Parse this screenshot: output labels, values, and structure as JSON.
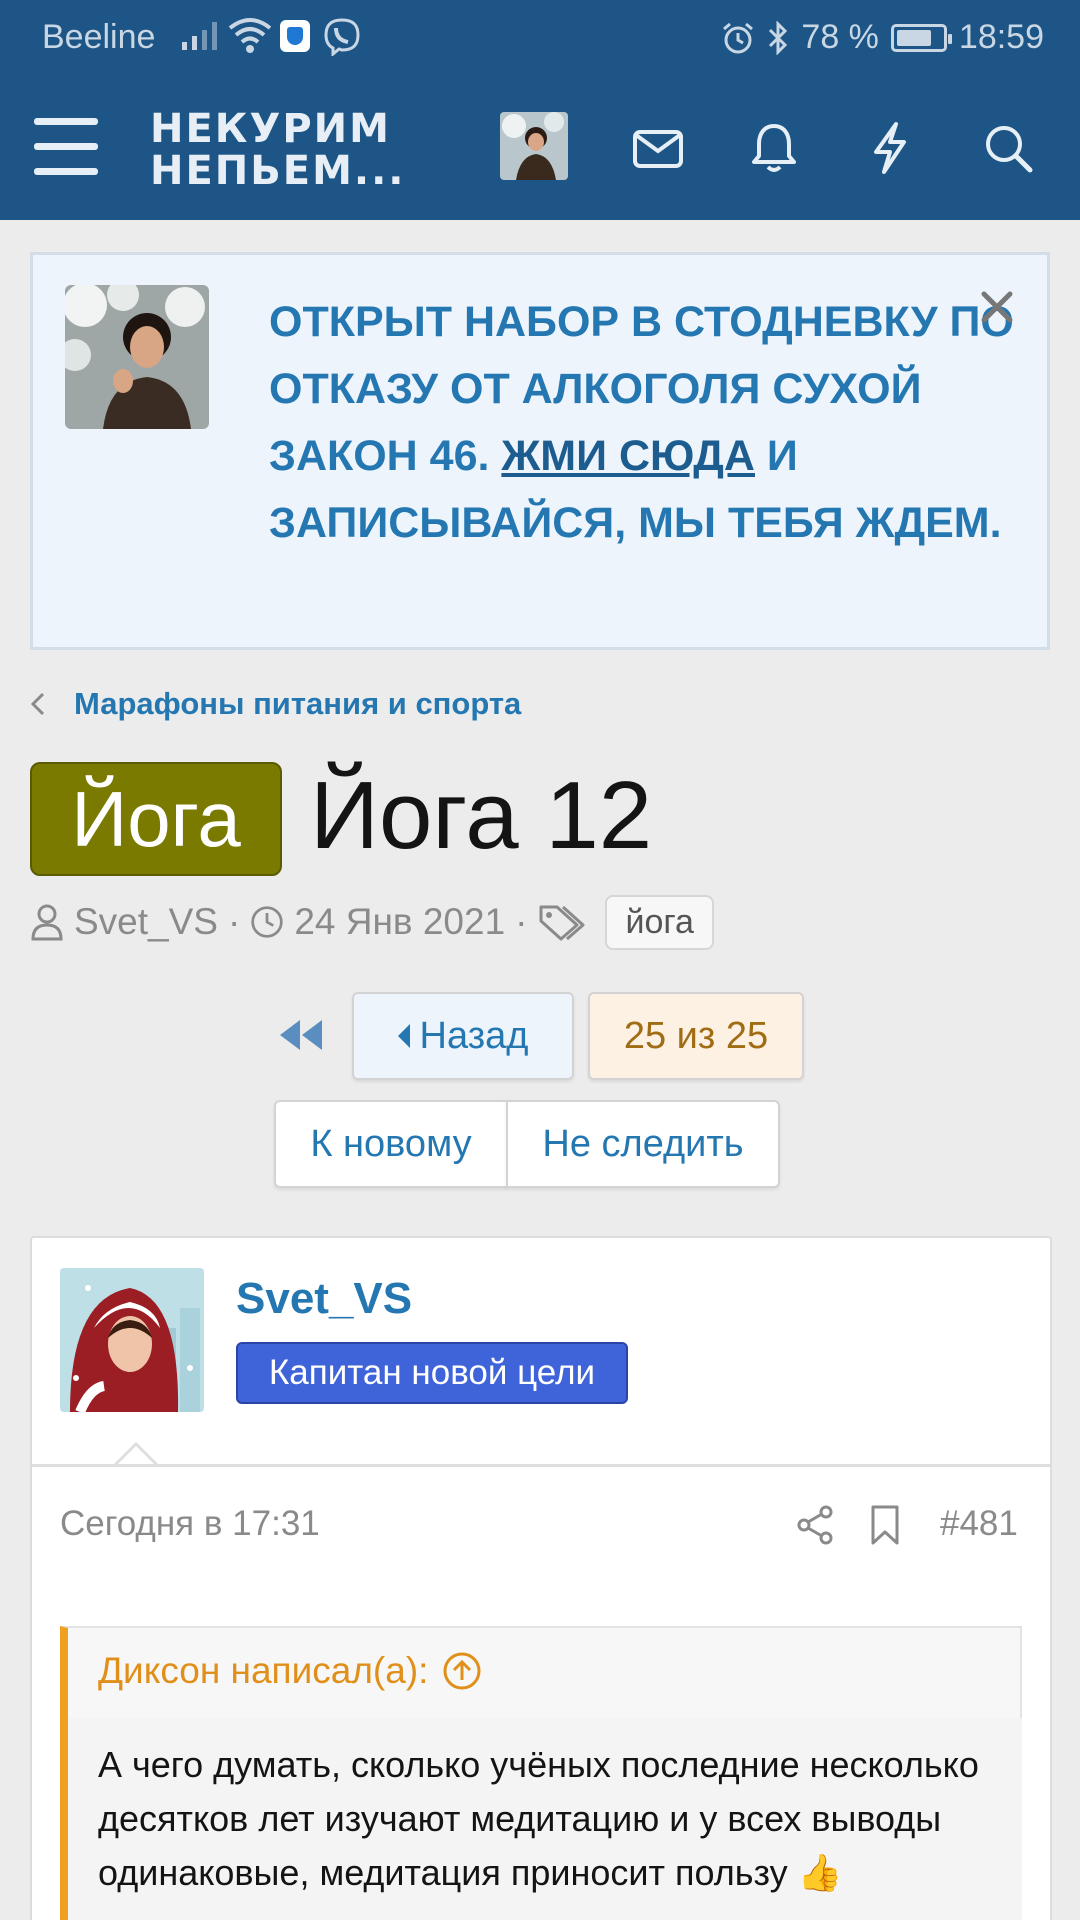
{
  "status_bar": {
    "carrier": "Beeline",
    "battery": "78 %",
    "battery_level": 0.78,
    "time": "18:59"
  },
  "header": {
    "logo_line1": "НЕКУРИМ",
    "logo_line2": "НЕПЬЕМ...",
    "icons": [
      "menu-icon",
      "avatar",
      "envelope-icon",
      "bell-icon",
      "lightning-icon",
      "search-icon"
    ]
  },
  "notice": {
    "text_before": "ОТКРЫТ НАБОР В СТОДНЕВКУ ПО ОТКАЗУ ОТ АЛКОГОЛЯ СУХОЙ ЗАКОН 46. ",
    "link": "ЖМИ СЮДА",
    "text_after": " И ЗАПИСЫВАЙСЯ, МЫ ТЕБЯ ЖДЕМ."
  },
  "breadcrumb": "Марафоны питания и спорта",
  "thread": {
    "prefix": "Йога",
    "title": "Йога 12",
    "author": "Svet_VS",
    "date": "24 Янв 2021",
    "tag": "йога"
  },
  "pager": {
    "back": "Назад",
    "page": "25 из 25",
    "new": "К новому",
    "unwatch": "Не следить"
  },
  "post": {
    "username": "Svet_VS",
    "rank": "Капитан новой цели",
    "date": "Сегодня в 17:31",
    "number": "#481",
    "quote_author": "Диксон написал(а):",
    "quote_text": "А чего думать, сколько учёных последние несколько десятков лет изучают медитацию и у всех выводы одинаковые, медитация приносит пользу 👍"
  },
  "colors": {
    "brand": "#1d5686",
    "link": "#2577b1",
    "prefix": "#7a7a00",
    "rank": "#3f63d9",
    "quote_accent": "#f0a020"
  }
}
